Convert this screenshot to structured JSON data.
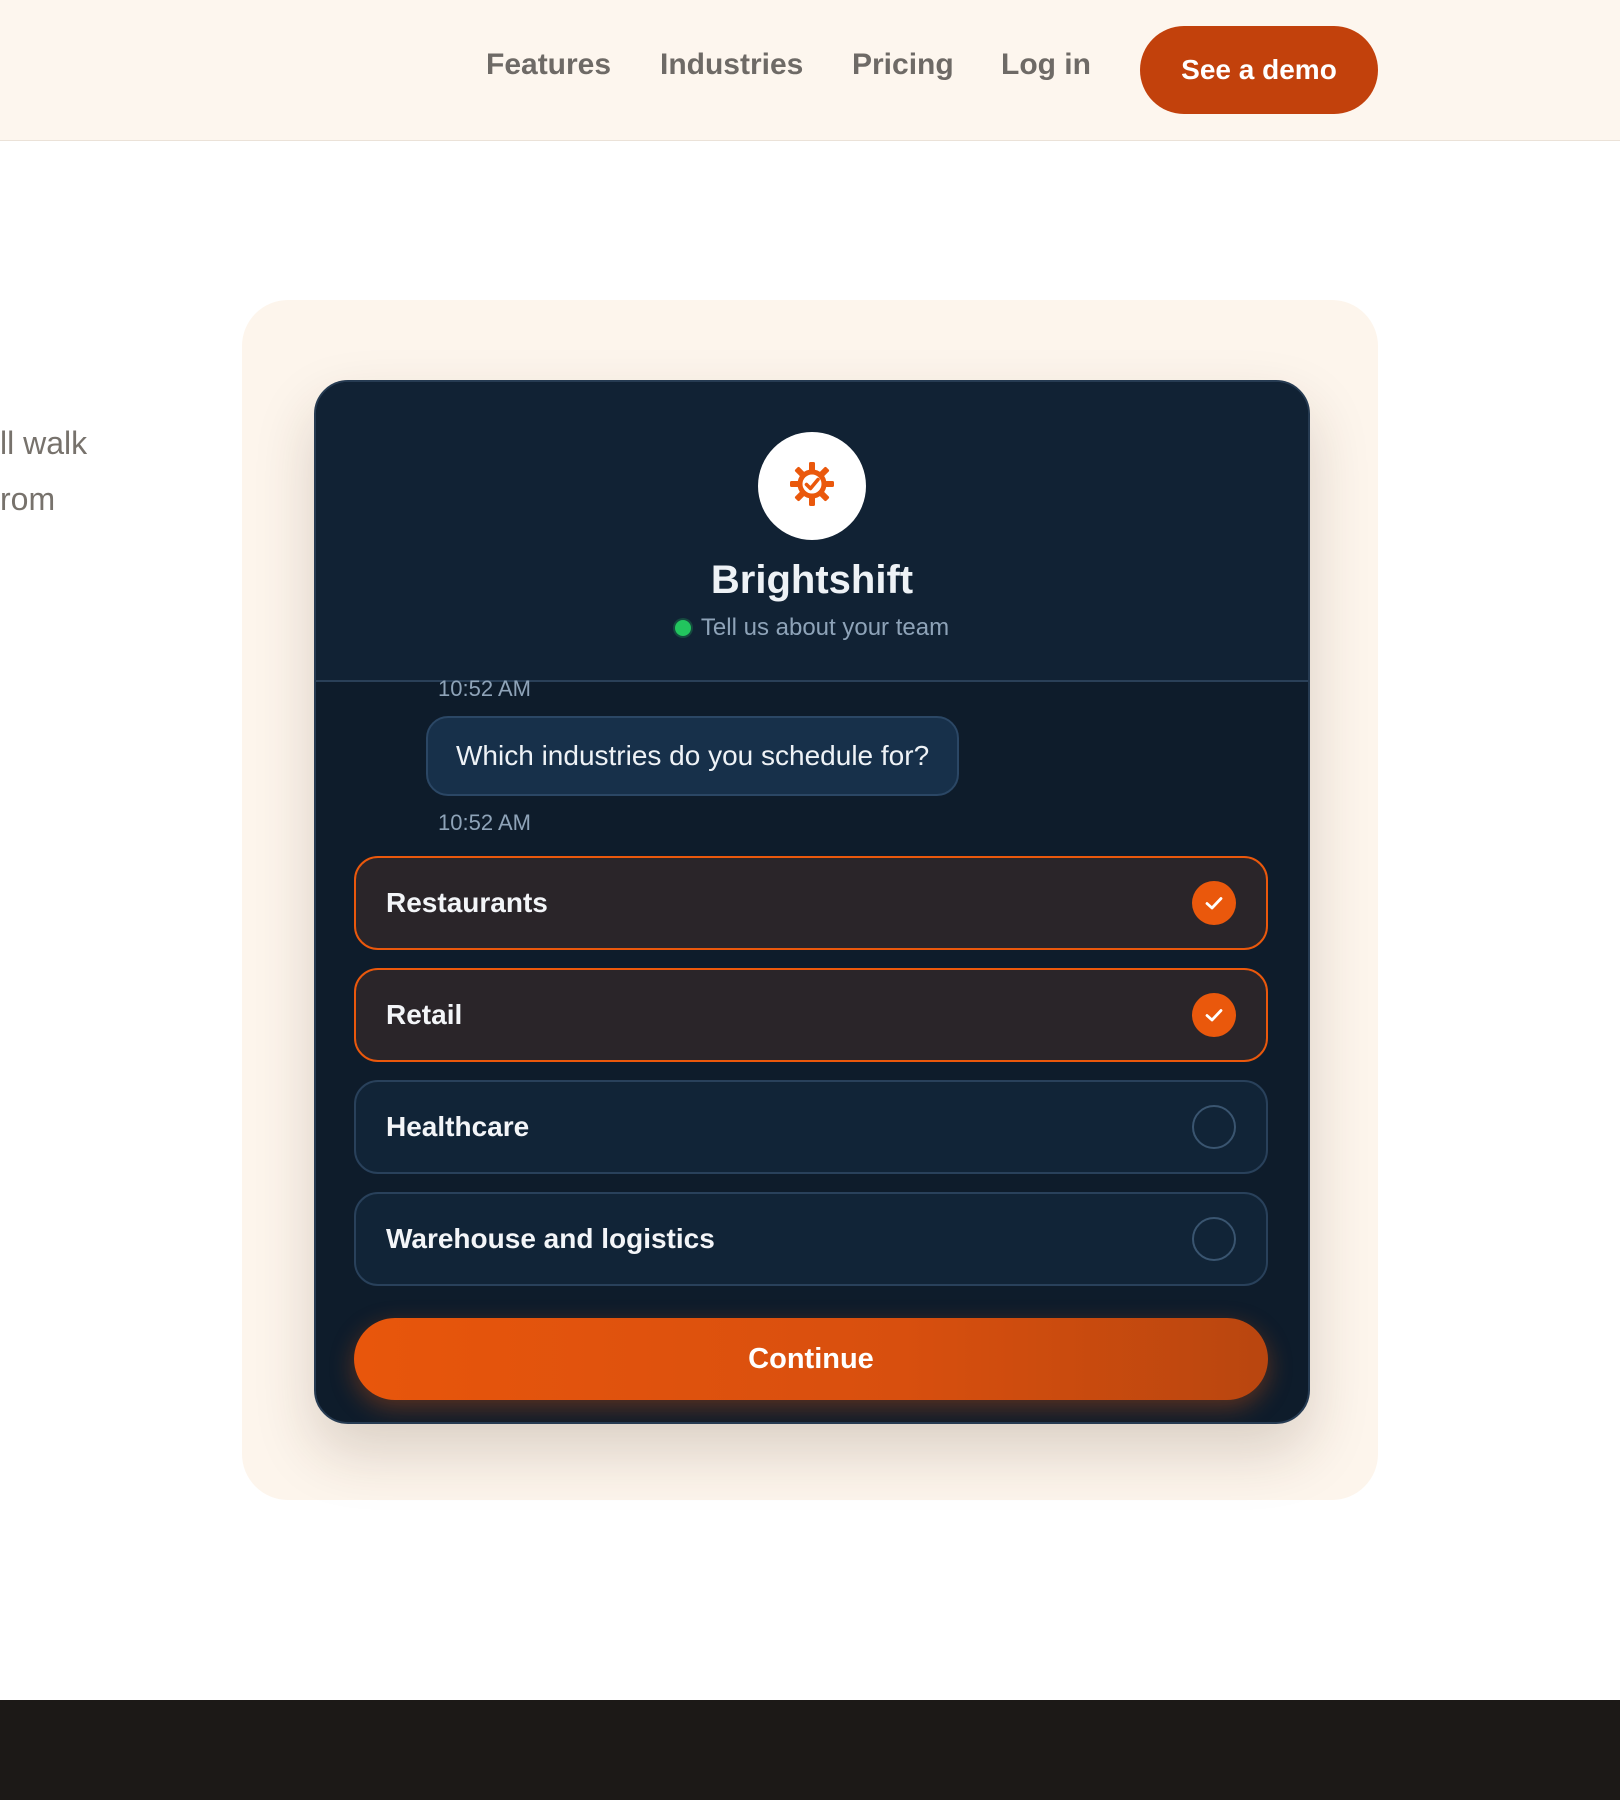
{
  "nav": {
    "links": [
      "Features",
      "Industries",
      "Pricing",
      "Log in"
    ],
    "cta_label": "See a demo"
  },
  "hero": {
    "fragment_line1": "ll walk",
    "fragment_line2": "rom"
  },
  "chat": {
    "bot_name": "Brightshift",
    "status_text": "Tell us about your team",
    "avatar_icon": "gear-check-icon",
    "timestamp_top": "10:52 AM",
    "question": "Which industries do you schedule for?",
    "timestamp_question": "10:52 AM",
    "options": [
      {
        "label": "Restaurants",
        "selected": true
      },
      {
        "label": "Retail",
        "selected": true
      },
      {
        "label": "Healthcare",
        "selected": false
      },
      {
        "label": "Warehouse and logistics",
        "selected": false
      }
    ],
    "continue_label": "Continue"
  },
  "colors": {
    "accent": "#ea580c",
    "brand_button": "#c2410c",
    "chat_background": "#0e1c2b",
    "online_dot": "#22c55e",
    "nav_background": "#fdf6ee",
    "panel_background": "#fdf5ec",
    "footer": "#1c1917"
  }
}
